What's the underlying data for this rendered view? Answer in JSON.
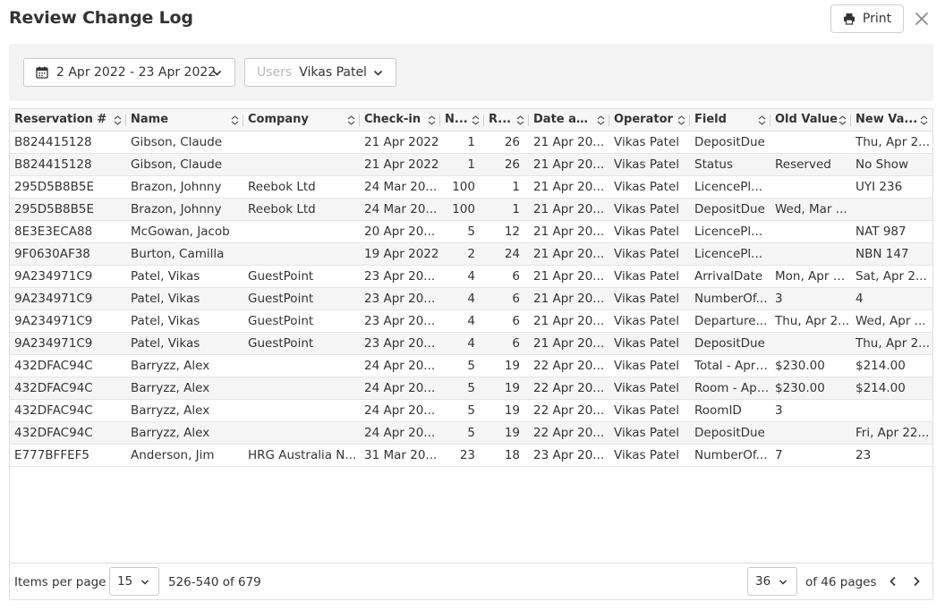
{
  "dialog": {
    "title": "Review Change Log",
    "print_label": "Print"
  },
  "filters": {
    "date_range": "2 Apr 2022 - 23 Apr 2022",
    "users_label": "Users",
    "users_value": "Vikas Patel"
  },
  "columns": [
    "Reservation #",
    "Name",
    "Company",
    "Check-in",
    "Nights",
    "Rooms",
    "Date and Time",
    "Operator",
    "Field",
    "Old Value",
    "New Value"
  ],
  "columns_display": [
    "Reservation #",
    "Name",
    "Company",
    "Check-in",
    "N...",
    "R...",
    "Date an...",
    "Operator",
    "Field",
    "Old Value",
    "New Va..."
  ],
  "rows": [
    [
      "B824415128",
      "Gibson, Claude",
      "",
      "21 Apr 2022",
      "1",
      "26",
      "21 Apr 20...",
      "Vikas Patel",
      "DepositDue",
      "",
      "Thu, Apr 2..."
    ],
    [
      "B824415128",
      "Gibson, Claude",
      "",
      "21 Apr 2022",
      "1",
      "26",
      "21 Apr 20...",
      "Vikas Patel",
      "Status",
      "Reserved",
      "No Show"
    ],
    [
      "295D5B8B5E",
      "Brazon, Johnny",
      "Reebok Ltd",
      "24 Mar 20...",
      "100",
      "1",
      "21 Apr 20...",
      "Vikas Patel",
      "LicencePl...",
      "",
      "UYI 236"
    ],
    [
      "295D5B8B5E",
      "Brazon, Johnny",
      "Reebok Ltd",
      "24 Mar 20...",
      "100",
      "1",
      "21 Apr 20...",
      "Vikas Patel",
      "DepositDue",
      "Wed, Mar ...",
      ""
    ],
    [
      "8E3E3ECA88",
      "McGowan, Jacob",
      "",
      "20 Apr 20...",
      "5",
      "12",
      "21 Apr 20...",
      "Vikas Patel",
      "LicencePl...",
      "",
      "NAT 987"
    ],
    [
      "9F0630AF38",
      "Burton, Camilla",
      "",
      "19 Apr 2022",
      "2",
      "24",
      "21 Apr 20...",
      "Vikas Patel",
      "LicencePl...",
      "",
      "NBN 147"
    ],
    [
      "9A234971C9",
      "Patel, Vikas",
      "GuestPoint",
      "23 Apr 20...",
      "4",
      "6",
      "21 Apr 20...",
      "Vikas Patel",
      "ArrivalDate",
      "Mon, Apr 1...",
      "Sat, Apr 2..."
    ],
    [
      "9A234971C9",
      "Patel, Vikas",
      "GuestPoint",
      "23 Apr 20...",
      "4",
      "6",
      "21 Apr 20...",
      "Vikas Patel",
      "NumberOf...",
      "3",
      "4"
    ],
    [
      "9A234971C9",
      "Patel, Vikas",
      "GuestPoint",
      "23 Apr 20...",
      "4",
      "6",
      "21 Apr 20...",
      "Vikas Patel",
      "Departure...",
      "Thu, Apr 2...",
      "Wed, Apr ..."
    ],
    [
      "9A234971C9",
      "Patel, Vikas",
      "GuestPoint",
      "23 Apr 20...",
      "4",
      "6",
      "21 Apr 20...",
      "Vikas Patel",
      "DepositDue",
      "",
      "Thu, Apr 2..."
    ],
    [
      "432DFAC94C",
      "Barryzz, Alex",
      "",
      "24 Apr 20...",
      "5",
      "19",
      "22 Apr 20...",
      "Vikas Patel",
      "Total - Apr ...",
      "$230.00",
      "$214.00"
    ],
    [
      "432DFAC94C",
      "Barryzz, Alex",
      "",
      "24 Apr 20...",
      "5",
      "19",
      "22 Apr 20...",
      "Vikas Patel",
      "Room - Apr...",
      "$230.00",
      "$214.00"
    ],
    [
      "432DFAC94C",
      "Barryzz, Alex",
      "",
      "24 Apr 20...",
      "5",
      "19",
      "22 Apr 20...",
      "Vikas Patel",
      "RoomID",
      "3",
      ""
    ],
    [
      "432DFAC94C",
      "Barryzz, Alex",
      "",
      "24 Apr 20...",
      "5",
      "19",
      "22 Apr 20...",
      "Vikas Patel",
      "DepositDue",
      "",
      "Fri, Apr 22..."
    ],
    [
      "E777BFFEF5",
      "Anderson, Jim",
      "HRG Australia N...",
      "31 Mar 20...",
      "23",
      "18",
      "23 Apr 20...",
      "Vikas Patel",
      "NumberOf...",
      "7",
      "23"
    ]
  ],
  "pagination": {
    "items_per_page_label": "Items per page",
    "items_per_page": "15",
    "range": "526-540 of 679",
    "current_page": "36",
    "pages_text": "of 46 pages"
  },
  "icons": {
    "print": "printer-icon",
    "close": "close-icon",
    "calendar": "calendar-icon",
    "sort": "sort-icon",
    "chevron": "chevron-down-icon"
  }
}
